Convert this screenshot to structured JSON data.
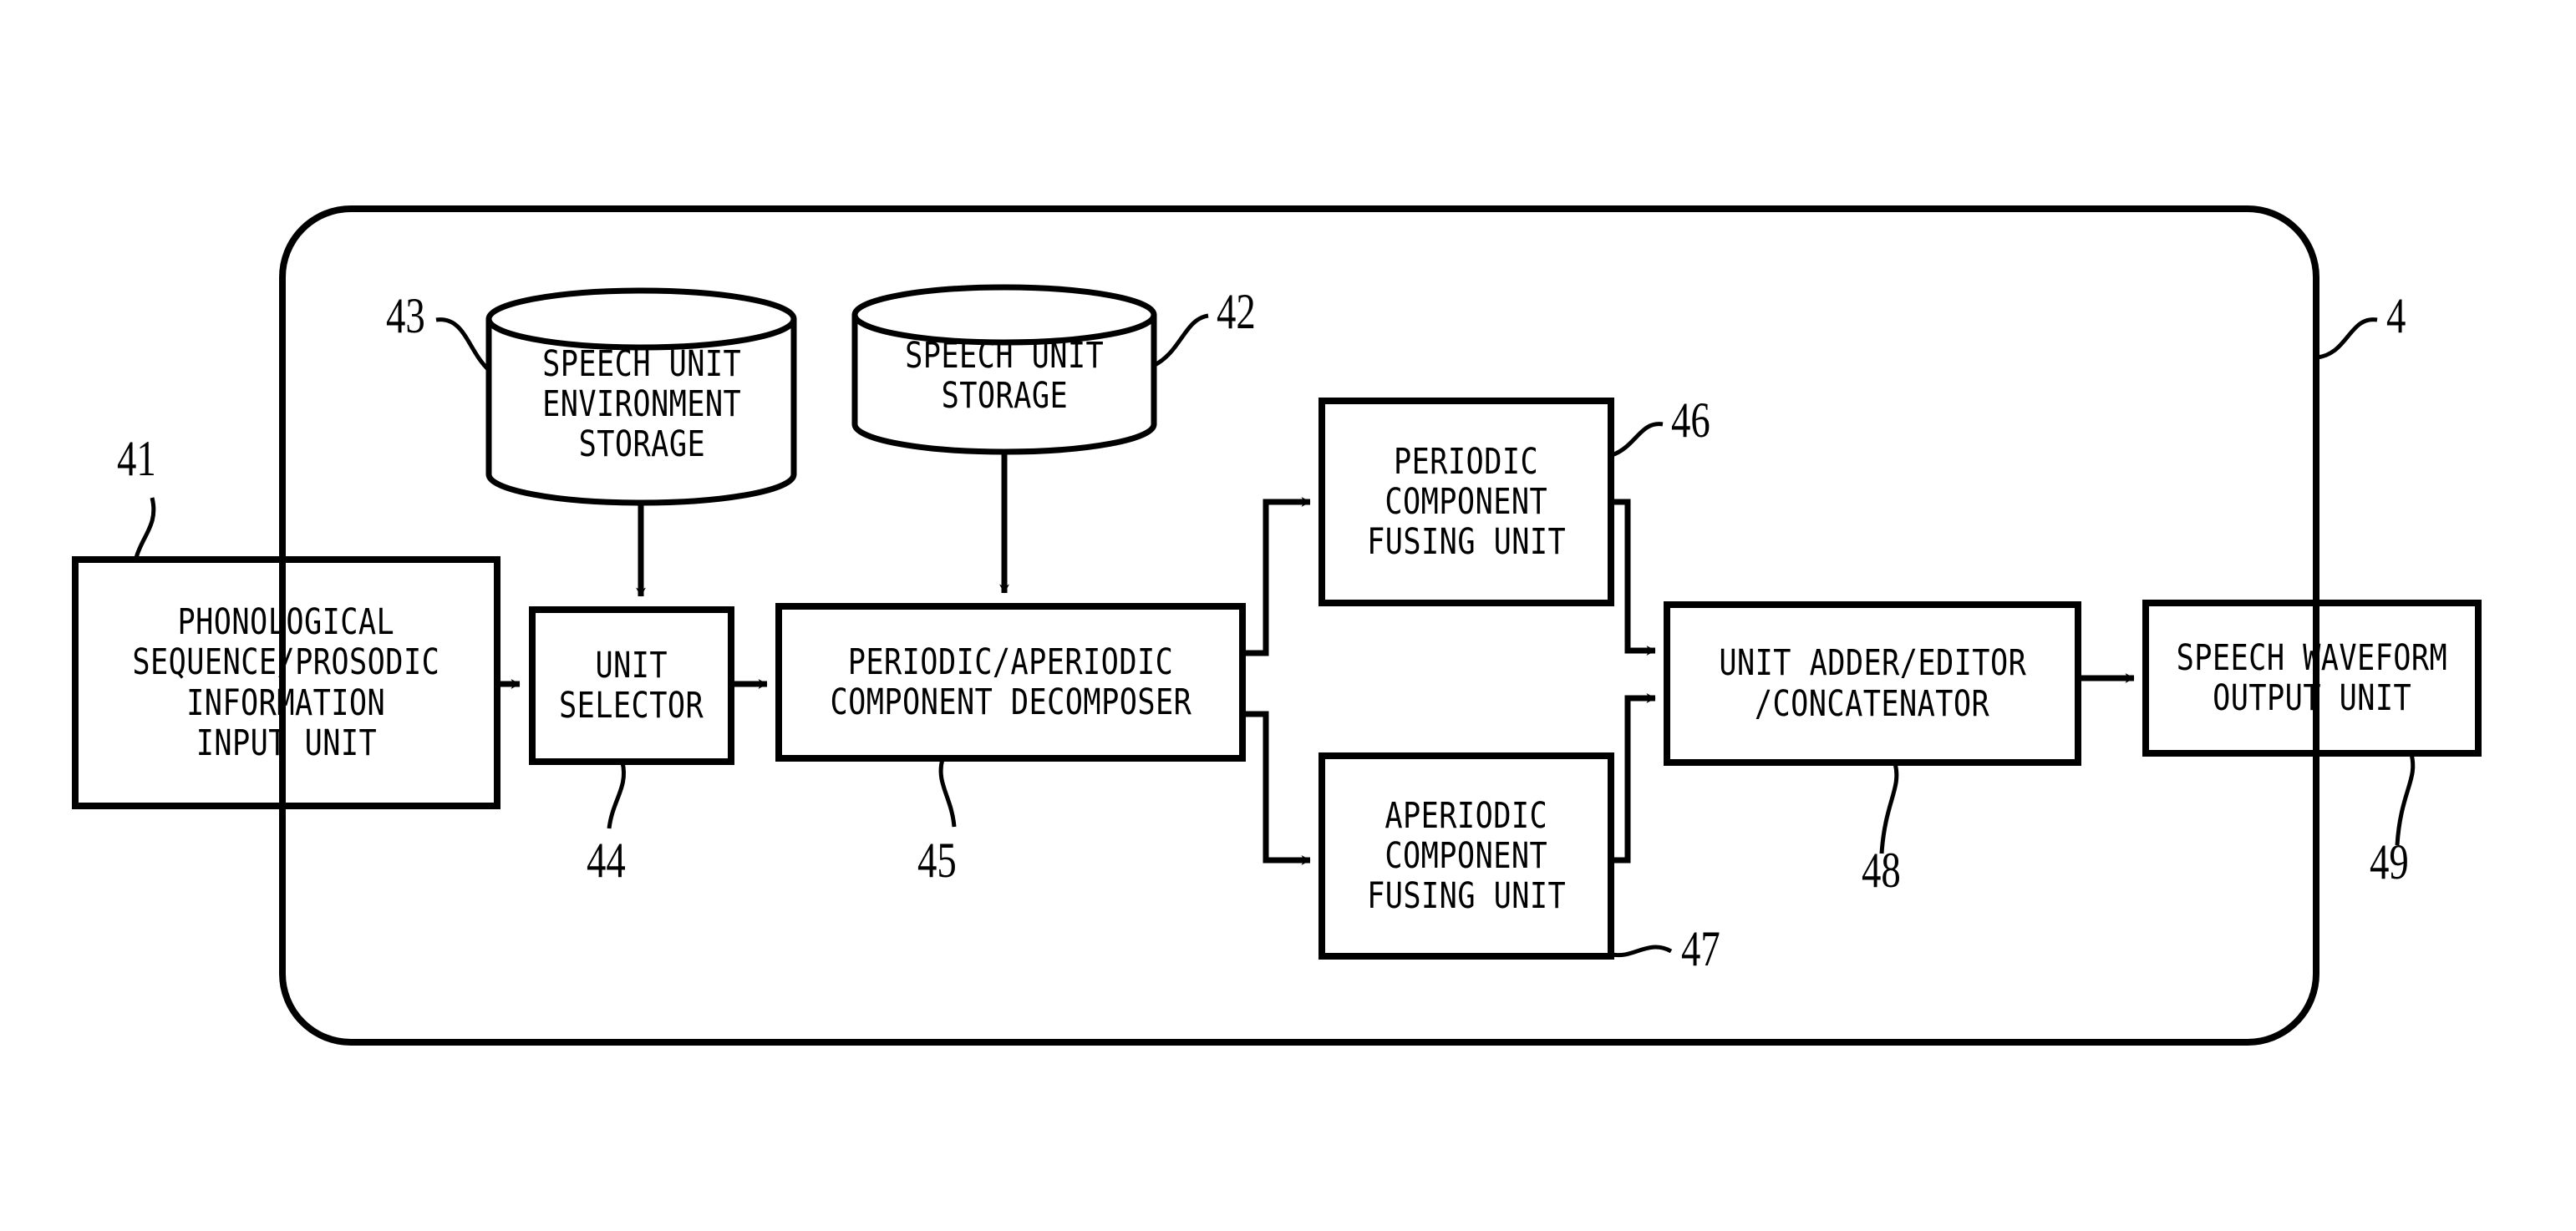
{
  "figure": {
    "kind": "patent-block-diagram",
    "line_color": "#000000",
    "background_color": "#ffffff",
    "outer_container_ref": "4"
  },
  "blocks": [
    {
      "id": "input-unit",
      "ref": "41",
      "shape": "rectangle",
      "lines": [
        "PHONOLOGICAL",
        "SEQUENCE/PROSODIC",
        "INFORMATION",
        "INPUT UNIT"
      ]
    },
    {
      "id": "speech-unit-environment-storage",
      "ref": "43",
      "shape": "cylinder",
      "lines": [
        "SPEECH UNIT",
        "ENVIRONMENT",
        "STORAGE"
      ]
    },
    {
      "id": "speech-unit-storage",
      "ref": "42",
      "shape": "cylinder",
      "lines": [
        "SPEECH UNIT",
        "STORAGE"
      ]
    },
    {
      "id": "unit-selector",
      "ref": "44",
      "shape": "rectangle",
      "lines": [
        "UNIT",
        "SELECTOR"
      ]
    },
    {
      "id": "component-decomposer",
      "ref": "45",
      "shape": "rectangle",
      "lines": [
        "PERIODIC/APERIODIC",
        "COMPONENT DECOMPOSER"
      ]
    },
    {
      "id": "periodic-component-fusing-unit",
      "ref": "46",
      "shape": "rectangle",
      "lines": [
        "PERIODIC",
        "COMPONENT",
        "FUSING UNIT"
      ]
    },
    {
      "id": "aperiodic-component-fusing-unit",
      "ref": "47",
      "shape": "rectangle",
      "lines": [
        "APERIODIC",
        "COMPONENT",
        "FUSING UNIT"
      ]
    },
    {
      "id": "unit-adder-editor-concatenator",
      "ref": "48",
      "shape": "rectangle",
      "lines": [
        "UNIT ADDER/EDITOR",
        "/CONCATENATOR"
      ]
    },
    {
      "id": "speech-waveform-output-unit",
      "ref": "49",
      "shape": "rectangle",
      "lines": [
        "SPEECH WAVEFORM",
        "OUTPUT UNIT"
      ]
    }
  ],
  "reference_numerals": {
    "container": "4",
    "input_unit": "41",
    "speech_unit_storage": "42",
    "speech_unit_environment_storage": "43",
    "unit_selector": "44",
    "component_decomposer": "45",
    "periodic_fusing_unit": "46",
    "aperiodic_fusing_unit": "47",
    "unit_adder": "48",
    "waveform_output_unit": "49"
  },
  "connections": [
    {
      "from": "input-unit",
      "to": "unit-selector",
      "style": "arrow-right"
    },
    {
      "from": "speech-unit-environment-storage",
      "to": "unit-selector",
      "style": "arrow-down"
    },
    {
      "from": "unit-selector",
      "to": "component-decomposer",
      "style": "arrow-right"
    },
    {
      "from": "speech-unit-storage",
      "to": "component-decomposer",
      "style": "arrow-down"
    },
    {
      "from": "component-decomposer",
      "to": "periodic-component-fusing-unit",
      "style": "branch-up-arrow-right"
    },
    {
      "from": "component-decomposer",
      "to": "aperiodic-component-fusing-unit",
      "style": "branch-down-arrow-right"
    },
    {
      "from": "periodic-component-fusing-unit",
      "to": "unit-adder-editor-concatenator",
      "style": "merge-down-arrow-right"
    },
    {
      "from": "aperiodic-component-fusing-unit",
      "to": "unit-adder-editor-concatenator",
      "style": "merge-up-arrow-right"
    },
    {
      "from": "unit-adder-editor-concatenator",
      "to": "speech-waveform-output-unit",
      "style": "arrow-right"
    }
  ]
}
